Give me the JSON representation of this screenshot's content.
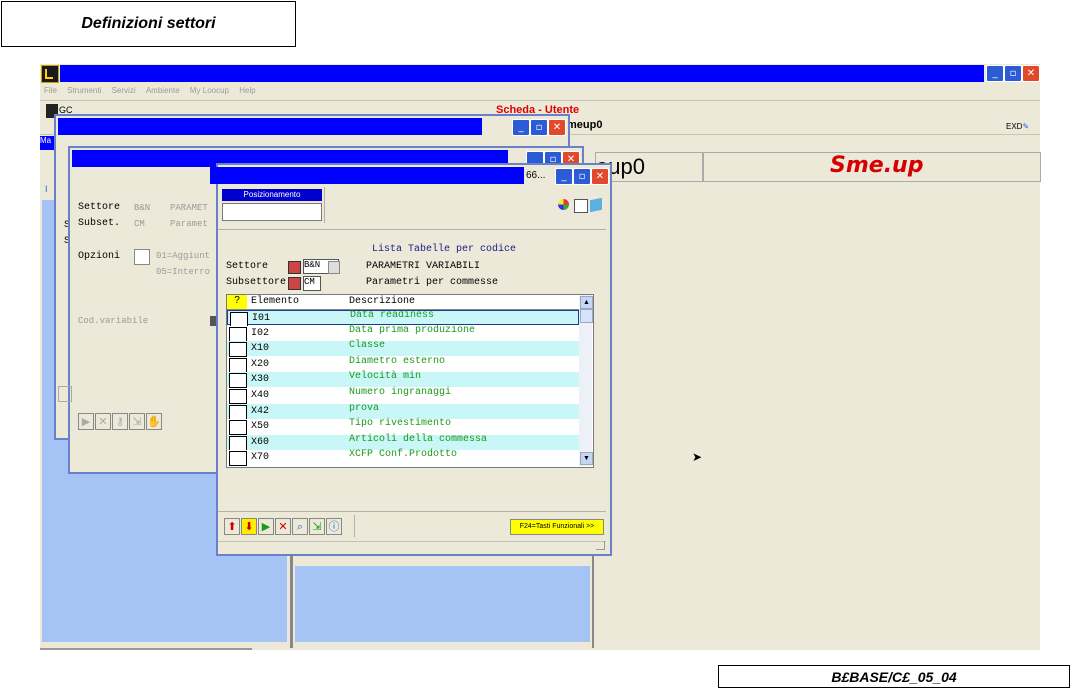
{
  "doc": {
    "title": "Definizioni settori",
    "code": "B£BASE/C£_05_04"
  },
  "menu": [
    "File",
    "Strumenti",
    "Servizi",
    "Ambiente",
    "My Loocup",
    "Help"
  ],
  "main": {
    "left_label": "GC",
    "scheda_title": "Scheda - Utente",
    "user_partial": "meup0",
    "exd_label": "EXD",
    "user_big": "eup0",
    "logo": "Sme.up",
    "side_letter": "Ma",
    "side_letter2": "I"
  },
  "form_back": {
    "settore_label": "Settore",
    "settore_value": "B&N",
    "settore_desc": "PARAMET",
    "subset_label": "Subset.",
    "subset_value": "CM",
    "subset_desc": "Paramet",
    "opzioni_label": "Opzioni",
    "opt1": "01=Aggiunt",
    "opt2": "05=Interro",
    "codvar_label": "Cod.variabile",
    "s1": "S",
    "s2": "S"
  },
  "dialog": {
    "title_suffix": "66...",
    "posizionamento_label": "Posizionamento",
    "posizionamento_value": "",
    "heading": "Lista Tabelle per codice",
    "settore_label": "Settore",
    "settore_value": "B&N",
    "settore_desc": "PARAMETRI VARIABILI",
    "subsettore_label": "Subsettore",
    "subsettore_value": "CM",
    "subsettore_desc": "Parametri per commesse",
    "col_q": "?",
    "col_elemento": "Elemento",
    "col_descrizione": "Descrizione",
    "rows": [
      {
        "code": "I01",
        "desc": "Data readiness"
      },
      {
        "code": "I02",
        "desc": "Data prima produzione"
      },
      {
        "code": "X10",
        "desc": "Classe"
      },
      {
        "code": "X20",
        "desc": "Diametro esterno"
      },
      {
        "code": "X30",
        "desc": "Velocità min"
      },
      {
        "code": "X40",
        "desc": "Numero ingranaggi"
      },
      {
        "code": "X42",
        "desc": "prova"
      },
      {
        "code": "X50",
        "desc": "Tipo rivestimento"
      },
      {
        "code": "X60",
        "desc": "Articoli della commessa"
      },
      {
        "code": "X70",
        "desc": "XCFP Conf.Prodotto"
      }
    ],
    "f24_label": "F24=Tasti Funzionali >>"
  }
}
